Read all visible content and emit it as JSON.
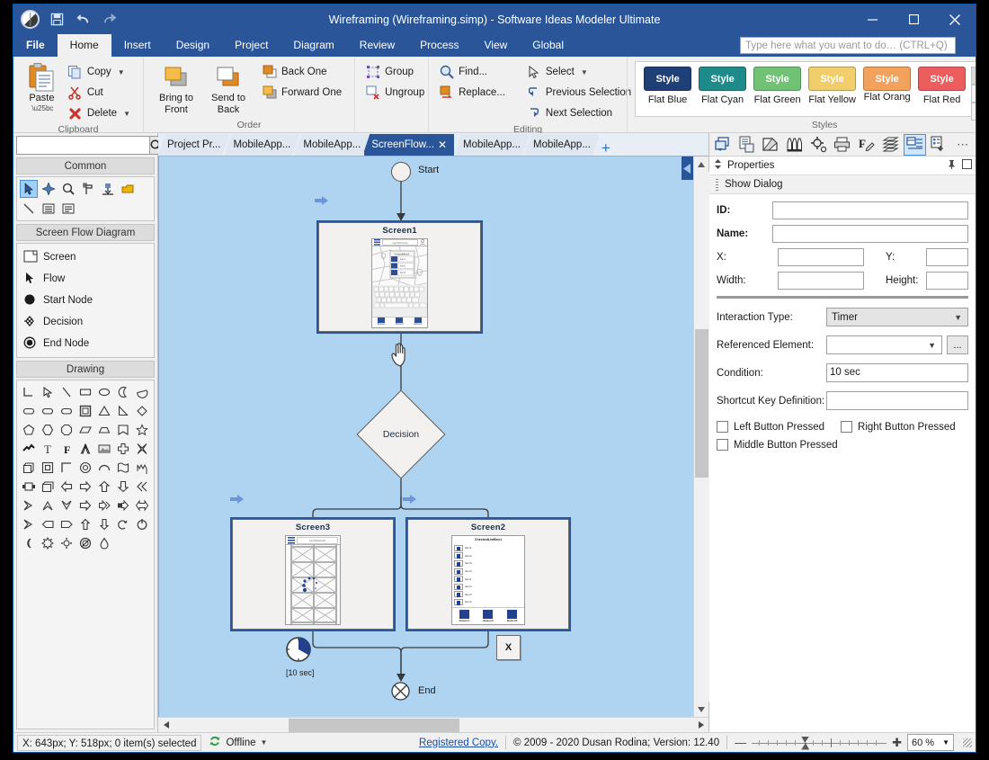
{
  "window": {
    "title": "Wireframing (Wireframing.simp)  - Software Ideas Modeler Ultimate",
    "minimize": "–",
    "maximize": "☐",
    "close": "✕"
  },
  "quick_access": {
    "save": "save-icon",
    "undo": "undo-icon",
    "redo": "redo-icon"
  },
  "ribbon": {
    "tabs": [
      {
        "label": "File",
        "active": false,
        "file": true
      },
      {
        "label": "Home",
        "active": true
      },
      {
        "label": "Insert",
        "active": false
      },
      {
        "label": "Design",
        "active": false
      },
      {
        "label": "Project",
        "active": false
      },
      {
        "label": "Diagram",
        "active": false
      },
      {
        "label": "Review",
        "active": false
      },
      {
        "label": "Process",
        "active": false
      },
      {
        "label": "View",
        "active": false
      },
      {
        "label": "Global",
        "active": false
      }
    ],
    "search_placeholder": "Type here what you want to do…  (CTRL+Q)",
    "groups": {
      "clipboard": {
        "title": "Clipboard",
        "paste": "Paste",
        "copy": "Copy",
        "cut": "Cut",
        "delete": "Delete"
      },
      "order": {
        "title": "Order",
        "bring_to_front": "Bring to\nFront",
        "bring_to_front_l1": "Bring to",
        "bring_to_front_l2": "Front",
        "send_to_back_l1": "Send to",
        "send_to_back_l2": "Back",
        "back_one": "Back One",
        "forward_one": "Forward One",
        "group": "Group",
        "ungroup": "Ungroup"
      },
      "editing": {
        "title": "Editing",
        "find": "Find...",
        "replace": "Replace...",
        "select": "Select",
        "previous_selection": "Previous Selection",
        "next_selection": "Next Selection"
      },
      "styles": {
        "title": "Styles",
        "chip_label": "Style",
        "items": [
          {
            "label": "Flat Blue",
            "color": "#1f3f77"
          },
          {
            "label": "Flat Cyan",
            "color": "#1f8a8a"
          },
          {
            "label": "Flat Green",
            "color": "#72c276"
          },
          {
            "label": "Flat Yellow",
            "color": "#f2cd6b"
          },
          {
            "label": "Flat Orang",
            "color": "#f2a25c"
          },
          {
            "label": "Flat Red",
            "color": "#ec5d5d"
          }
        ]
      }
    }
  },
  "toolbox": {
    "search_value": "",
    "sections": [
      {
        "title": "Common"
      },
      {
        "title": "Screen Flow Diagram"
      },
      {
        "title": "Drawing"
      }
    ],
    "common_icons": [
      "pointer-icon",
      "move-icon",
      "magnifier-icon",
      "format-painter-icon",
      "insert-icon",
      "note-icon",
      "line-icon",
      "list-icon",
      "list2-icon"
    ],
    "screen_flow_items": [
      {
        "label": "Screen",
        "icon": "screen-icon"
      },
      {
        "label": "Flow",
        "icon": "flow-arrow-icon"
      },
      {
        "label": "Start Node",
        "icon": "start-node-icon"
      },
      {
        "label": "Decision",
        "icon": "decision-icon"
      },
      {
        "label": "End Node",
        "icon": "end-node-icon"
      }
    ],
    "drawing_glyphs": [
      "⌐",
      "↖",
      "╲",
      "▭",
      "◯",
      "☾",
      "◖",
      "▭",
      "▭",
      "▭",
      "▣",
      "△",
      "◥",
      "◇",
      "⬠",
      "⬡",
      "⬡",
      "▱",
      "⬓",
      "☆",
      "☆",
      "≋",
      "T",
      "F",
      "A",
      "▤",
      "✚",
      "✕",
      "◱",
      "▣",
      "⌜",
      "◎",
      "⌒",
      "▱",
      "〰",
      "▦",
      "□",
      "⇦",
      "⇨",
      "⇧",
      "⇩",
      "≪",
      "≻",
      "⌃",
      "⌄",
      "⇨",
      "⇛",
      "⇨",
      "⇔",
      "≻",
      "⇦",
      "⇨",
      "⇧",
      "⇩",
      "↺",
      "↻",
      "☾",
      "✹",
      "⚙",
      "⊘",
      "◉"
    ]
  },
  "tabs": {
    "items": [
      {
        "label": "Project Pr...",
        "active": false
      },
      {
        "label": "MobileApp...",
        "active": false
      },
      {
        "label": "MobileApp...",
        "active": false
      },
      {
        "label": "ScreenFlow...",
        "active": true,
        "close": "✕"
      },
      {
        "label": "MobileApp...",
        "active": false
      },
      {
        "label": "MobileApp...",
        "active": false
      }
    ],
    "add": "+"
  },
  "diagram": {
    "start_label": "Start",
    "end_label": "End",
    "decision_label": "Decision",
    "timer_label": "[10 sec]",
    "close_marker": "X",
    "screens": [
      {
        "name": "Screen1",
        "selected": true
      },
      {
        "name": "Screen3",
        "selected": true
      },
      {
        "name": "Screen2",
        "selected": true
      }
    ],
    "screen1_phone": {
      "title": "AppTitlePanel1",
      "context_menu": "ContextMenu1",
      "menu_items": [
        "Item1",
        "Item2",
        "Item3"
      ],
      "buttons": [
        "Button1",
        "Button2",
        "Button3"
      ]
    },
    "screen3_phone": {
      "title": "AppTitlePanel2"
    },
    "screen2_phone": {
      "title": "CheckedListBox1",
      "items": [
        "Item1",
        "Item2",
        "Item3",
        "Item4",
        "Item1",
        "Item2",
        "Item3",
        "Item4"
      ],
      "buttons": [
        "Button1",
        "Button2",
        "Button3"
      ]
    }
  },
  "properties": {
    "panel_title": "Properties",
    "pin": "⍑",
    "maximize": "□",
    "subtitle": "Show Dialog",
    "fields": {
      "id_label": "ID:",
      "id_value": "",
      "name_label": "Name:",
      "name_value": "",
      "x_label": "X:",
      "x_value": "",
      "y_label": "Y:",
      "y_value": "",
      "width_label": "Width:",
      "width_value": "",
      "height_label": "Height:",
      "height_value": "",
      "interaction_type_label": "Interaction Type:",
      "interaction_type_value": "Timer",
      "referenced_element_label": "Referenced Element:",
      "referenced_element_value": "",
      "referenced_element_browse": "...",
      "condition_label": "Condition:",
      "condition_value": "10 sec",
      "shortcut_label": "Shortcut Key Definition:",
      "shortcut_value": ""
    },
    "checkboxes": [
      {
        "label": "Left Button Pressed",
        "checked": false
      },
      {
        "label": "Right Button Pressed",
        "checked": false
      },
      {
        "label": "Middle Button Pressed",
        "checked": false
      }
    ],
    "toolbar_icons": [
      "document-properties-icon",
      "style-icon",
      "colors-icon",
      "settings-icon",
      "print-icon",
      "font-edit-icon",
      "layers-icon",
      "properties-icon",
      "tasks-icon",
      "more-icon"
    ]
  },
  "statusbar": {
    "coords": "X: 643px; Y: 518px; 0 item(s) selected",
    "offline": "Offline",
    "registered": "Registered Copy.",
    "copyright": "© 2009 - 2020 Dusan Rodina; Version: 12.40",
    "zoom_minus": "—",
    "zoom_plus": "✚",
    "zoom_value": "60 %"
  }
}
